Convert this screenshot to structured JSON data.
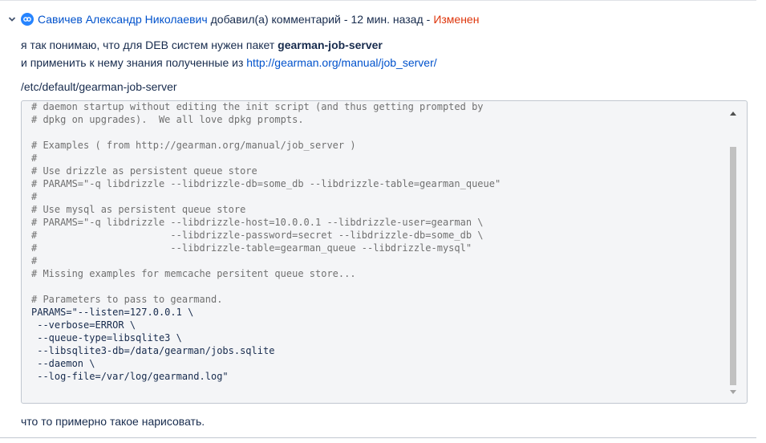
{
  "comment": {
    "author": "Савичев Александр Николаевич",
    "action": "добавил(а) комментарий",
    "separator_1": "-",
    "time": "12 мин. назад",
    "separator_2": "-",
    "edited_label": "Изменен"
  },
  "body": {
    "p1_line1_text": "я так понимаю, что для DEB систем нужен пакет ",
    "p1_line1_bold": "gearman-job-server",
    "p1_line2_text": "и применить к нему знания полученные из ",
    "p1_line2_link": "http://gearman.org/manual/job_server/",
    "p2_text": "/etc/default/gearman-job-server",
    "p3_text": "что то примерно такое нарисовать."
  },
  "code": {
    "lines": [
      {
        "text": "# daemon startup without editing the init script (and thus getting prompted by",
        "kind": "cmt"
      },
      {
        "text": "# dpkg on upgrades).  We all love dpkg prompts.",
        "kind": "cmt"
      },
      {
        "text": "",
        "kind": "cmt"
      },
      {
        "text": "# Examples ( from http://gearman.org/manual/job_server )",
        "kind": "cmt"
      },
      {
        "text": "#",
        "kind": "cmt"
      },
      {
        "text": "# Use drizzle as persistent queue store",
        "kind": "cmt"
      },
      {
        "text": "# PARAMS=\"-q libdrizzle --libdrizzle-db=some_db --libdrizzle-table=gearman_queue\"",
        "kind": "cmt"
      },
      {
        "text": "#",
        "kind": "cmt"
      },
      {
        "text": "# Use mysql as persistent queue store",
        "kind": "cmt"
      },
      {
        "text": "# PARAMS=\"-q libdrizzle --libdrizzle-host=10.0.0.1 --libdrizzle-user=gearman \\",
        "kind": "cmt"
      },
      {
        "text": "#                       --libdrizzle-password=secret --libdrizzle-db=some_db \\",
        "kind": "cmt"
      },
      {
        "text": "#                       --libdrizzle-table=gearman_queue --libdrizzle-mysql\"",
        "kind": "cmt"
      },
      {
        "text": "#",
        "kind": "cmt"
      },
      {
        "text": "# Missing examples for memcache persitent queue store...",
        "kind": "cmt"
      },
      {
        "text": "",
        "kind": "cmt"
      },
      {
        "text": "# Parameters to pass to gearmand.",
        "kind": "cmt"
      },
      {
        "text": "PARAMS=\"--listen=127.0.0.1 \\",
        "kind": "cfg"
      },
      {
        "text": " --verbose=ERROR \\",
        "kind": "cfg"
      },
      {
        "text": " --queue-type=libsqlite3 \\",
        "kind": "cfg"
      },
      {
        "text": " --libsqlite3-db=/data/gearman/jobs.sqlite",
        "kind": "cfg"
      },
      {
        "text": " --daemon \\",
        "kind": "cfg"
      },
      {
        "text": " --log-file=/var/log/gearmand.log\"",
        "kind": "cfg"
      }
    ]
  },
  "icons": {
    "collapse": "chevron-down-icon",
    "avatar": "user-avatar-icon",
    "scroll_up": "scroll-up-arrow-icon",
    "scroll_down": "scroll-down-arrow-icon"
  },
  "colors": {
    "author_link": "#0052cc",
    "edited": "#de350b",
    "code_background": "#f4f5f7"
  }
}
